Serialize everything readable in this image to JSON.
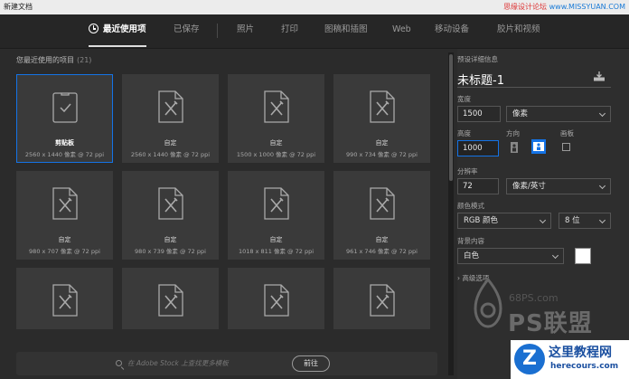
{
  "window": {
    "title": "新建文档"
  },
  "watermark_top": {
    "part1": "思缘设计论坛",
    "part2": "www.MISSYUAN.COM"
  },
  "tabs": [
    {
      "label": "最近使用项",
      "active": true
    },
    {
      "label": "已保存"
    },
    {
      "label": "照片"
    },
    {
      "label": "打印"
    },
    {
      "label": "图稿和插图"
    },
    {
      "label": "Web"
    },
    {
      "label": "移动设备"
    },
    {
      "label": "胶片和视频"
    }
  ],
  "recent": {
    "label": "您最近使用的项目",
    "count": "(21)",
    "items": [
      {
        "name": "剪贴板",
        "size": "2560 x 1440 像素 @ 72 ppi",
        "selected": true,
        "icon": "clipboard-check-icon"
      },
      {
        "name": "自定",
        "size": "2560 x 1440 像素 @ 72 ppi"
      },
      {
        "name": "自定",
        "size": "1500 x 1000 像素 @ 72 ppi"
      },
      {
        "name": "自定",
        "size": "990 x 734 像素 @ 72 ppi"
      },
      {
        "name": "自定",
        "size": "980 x 707 像素 @ 72 ppi"
      },
      {
        "name": "自定",
        "size": "980 x 739 像素 @ 72 ppi"
      },
      {
        "name": "自定",
        "size": "1018 x 811 像素 @ 72 ppi"
      },
      {
        "name": "自定",
        "size": "961 x 746 像素 @ 72 ppi"
      },
      {
        "name": "",
        "size": ""
      },
      {
        "name": "",
        "size": ""
      },
      {
        "name": "",
        "size": ""
      },
      {
        "name": "",
        "size": ""
      }
    ]
  },
  "stock": {
    "placeholder": "在 Adobe Stock 上查找更多模板",
    "go_label": "前往"
  },
  "preset": {
    "section_label": "预设详细信息",
    "title": "未标题-1",
    "width_label": "宽度",
    "width_value": "1500",
    "width_unit": "像素",
    "height_label": "高度",
    "height_value": "1000",
    "orientation_label": "方向",
    "artboard_label": "画板",
    "resolution_label": "分辨率",
    "resolution_value": "72",
    "resolution_unit": "像素/英寸",
    "color_mode_label": "颜色模式",
    "color_mode_value": "RGB 颜色",
    "bit_depth_value": "8 位",
    "background_label": "背景内容",
    "background_value": "白色",
    "background_color": "#ffffff",
    "advanced_label": "高级选项"
  },
  "watermark": {
    "site": "68PS.com",
    "ps_text": "PS联盟",
    "corner_cn": "这里教程网",
    "corner_en": "herecours.com",
    "corner_letter": "Z"
  },
  "colors": {
    "accent": "#1473e6",
    "bg": "#2b2b2b",
    "card": "#3a3a3a"
  }
}
